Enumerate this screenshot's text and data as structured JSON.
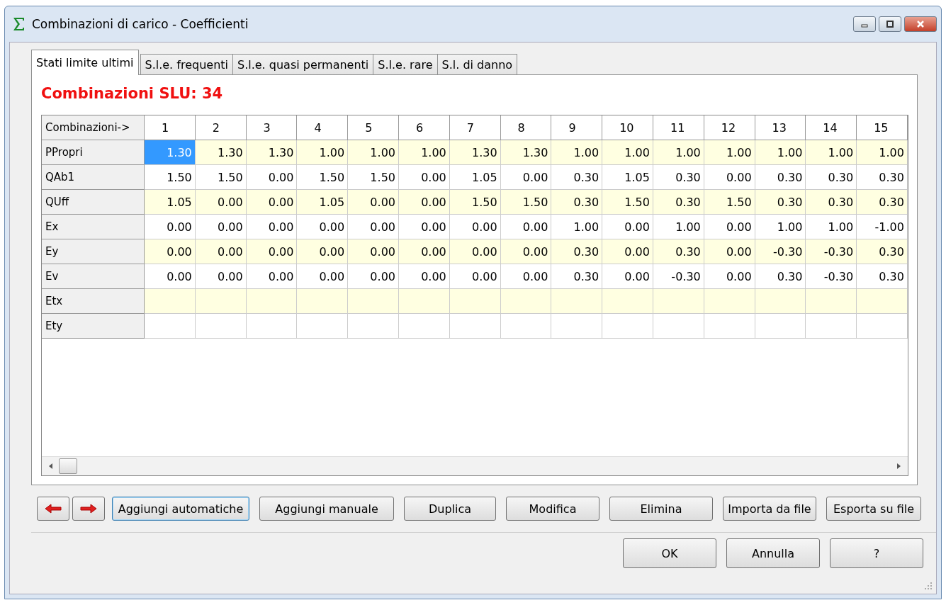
{
  "window": {
    "title": "Combinazioni di carico - Coefficienti"
  },
  "tabs": [
    {
      "label": "Stati limite ultimi",
      "selected": true
    },
    {
      "label": "S.l.e. frequenti",
      "selected": false
    },
    {
      "label": "S.l.e. quasi permanenti",
      "selected": false
    },
    {
      "label": "S.l.e. rare",
      "selected": false
    },
    {
      "label": "S.l. di danno",
      "selected": false
    }
  ],
  "heading": "Combinazioni SLU: 34",
  "table": {
    "corner": "Combinazioni->",
    "columns": [
      "1",
      "2",
      "3",
      "4",
      "5",
      "6",
      "7",
      "8",
      "9",
      "10",
      "11",
      "12",
      "13",
      "14",
      "15"
    ],
    "rows": [
      {
        "label": "PPropri",
        "cells": [
          {
            "text": "1.30",
            "selected": true
          },
          {
            "text": "1.30",
            "selected": false
          },
          {
            "text": "1.30",
            "selected": false
          },
          {
            "text": "1.00",
            "selected": false
          },
          {
            "text": "1.00",
            "selected": false
          },
          {
            "text": "1.00",
            "selected": false
          },
          {
            "text": "1.30",
            "selected": false
          },
          {
            "text": "1.30",
            "selected": false
          },
          {
            "text": "1.00",
            "selected": false
          },
          {
            "text": "1.00",
            "selected": false
          },
          {
            "text": "1.00",
            "selected": false
          },
          {
            "text": "1.00",
            "selected": false
          },
          {
            "text": "1.00",
            "selected": false
          },
          {
            "text": "1.00",
            "selected": false
          },
          {
            "text": "1.00",
            "selected": false
          }
        ]
      },
      {
        "label": "QAb1",
        "cells": [
          {
            "text": "1.50",
            "selected": false
          },
          {
            "text": "1.50",
            "selected": false
          },
          {
            "text": "0.00",
            "selected": false
          },
          {
            "text": "1.50",
            "selected": false
          },
          {
            "text": "1.50",
            "selected": false
          },
          {
            "text": "0.00",
            "selected": false
          },
          {
            "text": "1.05",
            "selected": false
          },
          {
            "text": "0.00",
            "selected": false
          },
          {
            "text": "0.30",
            "selected": false
          },
          {
            "text": "1.05",
            "selected": false
          },
          {
            "text": "0.30",
            "selected": false
          },
          {
            "text": "0.00",
            "selected": false
          },
          {
            "text": "0.30",
            "selected": false
          },
          {
            "text": "0.30",
            "selected": false
          },
          {
            "text": "0.30",
            "selected": false
          }
        ]
      },
      {
        "label": "QUff",
        "cells": [
          {
            "text": "1.05",
            "selected": false
          },
          {
            "text": "0.00",
            "selected": false
          },
          {
            "text": "0.00",
            "selected": false
          },
          {
            "text": "1.05",
            "selected": false
          },
          {
            "text": "0.00",
            "selected": false
          },
          {
            "text": "0.00",
            "selected": false
          },
          {
            "text": "1.50",
            "selected": false
          },
          {
            "text": "1.50",
            "selected": false
          },
          {
            "text": "0.30",
            "selected": false
          },
          {
            "text": "1.50",
            "selected": false
          },
          {
            "text": "0.30",
            "selected": false
          },
          {
            "text": "1.50",
            "selected": false
          },
          {
            "text": "0.30",
            "selected": false
          },
          {
            "text": "0.30",
            "selected": false
          },
          {
            "text": "0.30",
            "selected": false
          }
        ]
      },
      {
        "label": "Ex",
        "cells": [
          {
            "text": "0.00",
            "selected": false
          },
          {
            "text": "0.00",
            "selected": false
          },
          {
            "text": "0.00",
            "selected": false
          },
          {
            "text": "0.00",
            "selected": false
          },
          {
            "text": "0.00",
            "selected": false
          },
          {
            "text": "0.00",
            "selected": false
          },
          {
            "text": "0.00",
            "selected": false
          },
          {
            "text": "0.00",
            "selected": false
          },
          {
            "text": "1.00",
            "selected": false
          },
          {
            "text": "0.00",
            "selected": false
          },
          {
            "text": "1.00",
            "selected": false
          },
          {
            "text": "0.00",
            "selected": false
          },
          {
            "text": "1.00",
            "selected": false
          },
          {
            "text": "1.00",
            "selected": false
          },
          {
            "text": "-1.00",
            "selected": false
          }
        ]
      },
      {
        "label": "Ey",
        "cells": [
          {
            "text": "0.00",
            "selected": false
          },
          {
            "text": "0.00",
            "selected": false
          },
          {
            "text": "0.00",
            "selected": false
          },
          {
            "text": "0.00",
            "selected": false
          },
          {
            "text": "0.00",
            "selected": false
          },
          {
            "text": "0.00",
            "selected": false
          },
          {
            "text": "0.00",
            "selected": false
          },
          {
            "text": "0.00",
            "selected": false
          },
          {
            "text": "0.30",
            "selected": false
          },
          {
            "text": "0.00",
            "selected": false
          },
          {
            "text": "0.30",
            "selected": false
          },
          {
            "text": "0.00",
            "selected": false
          },
          {
            "text": "-0.30",
            "selected": false
          },
          {
            "text": "-0.30",
            "selected": false
          },
          {
            "text": "0.30",
            "selected": false
          }
        ]
      },
      {
        "label": "Ev",
        "cells": [
          {
            "text": "0.00",
            "selected": false
          },
          {
            "text": "0.00",
            "selected": false
          },
          {
            "text": "0.00",
            "selected": false
          },
          {
            "text": "0.00",
            "selected": false
          },
          {
            "text": "0.00",
            "selected": false
          },
          {
            "text": "0.00",
            "selected": false
          },
          {
            "text": "0.00",
            "selected": false
          },
          {
            "text": "0.00",
            "selected": false
          },
          {
            "text": "0.30",
            "selected": false
          },
          {
            "text": "0.00",
            "selected": false
          },
          {
            "text": "-0.30",
            "selected": false
          },
          {
            "text": "0.00",
            "selected": false
          },
          {
            "text": "0.30",
            "selected": false
          },
          {
            "text": "-0.30",
            "selected": false
          },
          {
            "text": "0.30",
            "selected": false
          }
        ]
      },
      {
        "label": "Etx",
        "cells": [
          {
            "selected": false
          },
          {
            "selected": false
          },
          {
            "selected": false
          },
          {
            "selected": false
          },
          {
            "selected": false
          },
          {
            "selected": false
          },
          {
            "selected": false
          },
          {
            "selected": false
          },
          {
            "selected": false
          },
          {
            "selected": false
          },
          {
            "selected": false
          },
          {
            "selected": false
          },
          {
            "selected": false
          },
          {
            "selected": false
          },
          {
            "selected": false
          }
        ]
      },
      {
        "label": "Ety",
        "cells": [
          {
            "selected": false
          },
          {
            "selected": false
          },
          {
            "selected": false
          },
          {
            "selected": false
          },
          {
            "selected": false
          },
          {
            "selected": false
          },
          {
            "selected": false
          },
          {
            "selected": false
          },
          {
            "selected": false
          },
          {
            "selected": false
          },
          {
            "selected": false
          },
          {
            "selected": false
          },
          {
            "selected": false
          },
          {
            "selected": false
          },
          {
            "selected": false
          }
        ]
      }
    ]
  },
  "action_buttons": [
    {
      "label": "Aggiungi automatiche",
      "focused": true
    },
    {
      "label": "Aggiungi manuale",
      "focused": false
    },
    {
      "label": "Duplica",
      "focused": false
    },
    {
      "label": "Modifica",
      "focused": false
    },
    {
      "label": "Elimina",
      "focused": false
    },
    {
      "label": "Importa da file",
      "focused": false
    },
    {
      "label": "Esporta su file",
      "focused": false
    }
  ],
  "dialog_buttons": [
    "OK",
    "Annulla",
    "?"
  ]
}
